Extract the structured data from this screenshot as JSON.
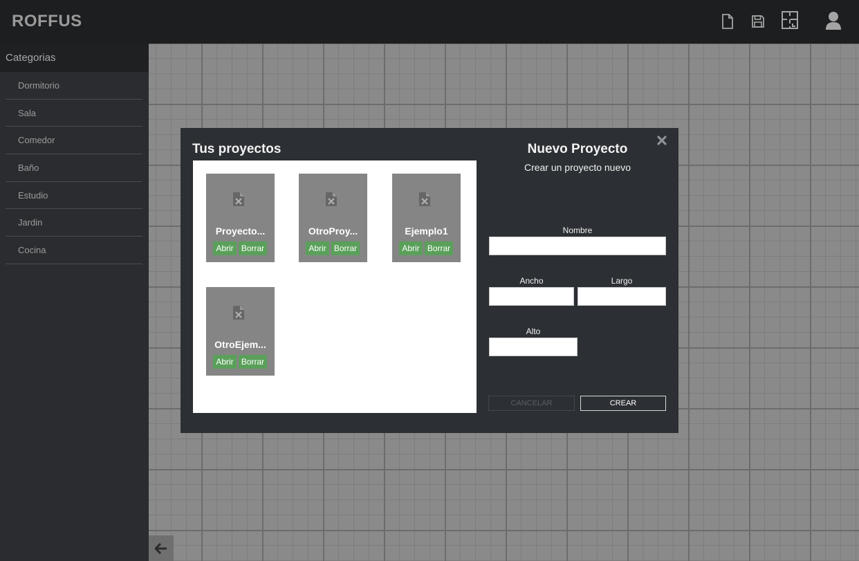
{
  "app": {
    "brand": "ROFFUS"
  },
  "toolbar": {
    "icons": [
      "new-file-icon",
      "save-icon",
      "floorplan-icon",
      "user-icon"
    ]
  },
  "sidebar": {
    "header": "Categorias",
    "items": [
      {
        "label": "Dormitorio"
      },
      {
        "label": "Sala"
      },
      {
        "label": "Comedor"
      },
      {
        "label": "Baño"
      },
      {
        "label": "Estudio"
      },
      {
        "label": "Jardin"
      },
      {
        "label": "Cocina"
      }
    ]
  },
  "modal": {
    "projects_title": "Tus proyectos",
    "projects": [
      {
        "name": "Proyecto...",
        "open_label": "Abrir",
        "delete_label": "Borrar"
      },
      {
        "name": "OtroProy...",
        "open_label": "Abrir",
        "delete_label": "Borrar"
      },
      {
        "name": "Ejemplo1",
        "open_label": "Abrir",
        "delete_label": "Borrar"
      },
      {
        "name": "OtroEjem...",
        "open_label": "Abrir",
        "delete_label": "Borrar"
      }
    ],
    "new_project": {
      "title": "Nuevo Proyecto",
      "subtitle": "Crear un proyecto nuevo",
      "name_label": "Nombre",
      "width_label": "Ancho",
      "length_label": "Largo",
      "height_label": "Alto",
      "name_value": "",
      "width_value": "",
      "length_value": "",
      "height_value": "",
      "cancel_label": "CANCELAR",
      "create_label": "CREAR"
    }
  },
  "colors": {
    "header_bg": "#1d1e20",
    "sidebar_bg": "#2a2c2f",
    "modal_bg": "#2c2f33",
    "card_bg": "#858585",
    "action_green": "#5aa05a"
  }
}
